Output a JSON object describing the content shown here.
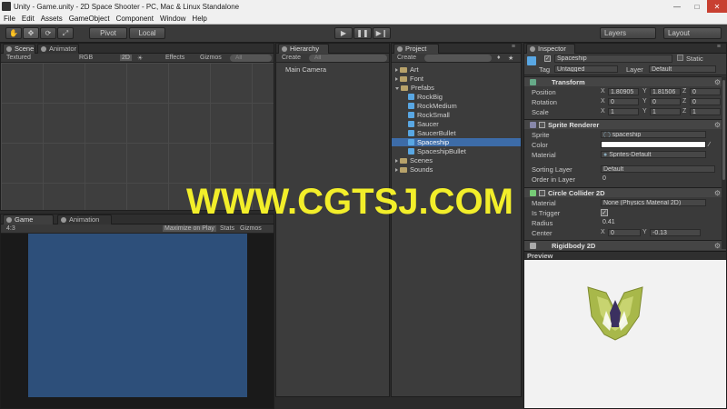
{
  "window": {
    "title": "Unity - Game.unity - 2D Space Shooter - PC, Mac & Linux Standalone"
  },
  "menu": [
    "File",
    "Edit",
    "Assets",
    "GameObject",
    "Component",
    "Window",
    "Help"
  ],
  "toolbar": {
    "pivot": "Pivot",
    "local": "Local",
    "layers": "Layers",
    "layout": "Layout"
  },
  "scene": {
    "tabs": [
      "Scene",
      "Animator"
    ],
    "shading": "Textured",
    "render": "RGB",
    "mode2d": "2D",
    "effects": "Effects",
    "gizmos": "Gizmos",
    "search": "All"
  },
  "game": {
    "tabs": [
      "Game",
      "Animation"
    ],
    "aspect": "4:3",
    "maximize": "Maximize on Play",
    "stats": "Stats",
    "gizmos": "Gizmos",
    "viewport_color": "#2d4f7a"
  },
  "hierarchy": {
    "tab": "Hierarchy",
    "create": "Create",
    "search": "All",
    "items": [
      "Main Camera"
    ]
  },
  "project": {
    "tab": "Project",
    "create": "Create",
    "items": [
      {
        "label": "Art",
        "type": "folder",
        "depth": 0,
        "open": false
      },
      {
        "label": "Font",
        "type": "folder",
        "depth": 0,
        "open": false
      },
      {
        "label": "Prefabs",
        "type": "folder",
        "depth": 0,
        "open": true
      },
      {
        "label": "RockBig",
        "type": "prefab",
        "depth": 1
      },
      {
        "label": "RockMedium",
        "type": "prefab",
        "depth": 1
      },
      {
        "label": "RockSmall",
        "type": "prefab",
        "depth": 1
      },
      {
        "label": "Saucer",
        "type": "prefab",
        "depth": 1
      },
      {
        "label": "SaucerBullet",
        "type": "prefab",
        "depth": 1
      },
      {
        "label": "Spaceship",
        "type": "prefab",
        "depth": 1,
        "selected": true
      },
      {
        "label": "SpaceshipBullet",
        "type": "prefab",
        "depth": 1
      },
      {
        "label": "Scenes",
        "type": "folder",
        "depth": 0,
        "open": false
      },
      {
        "label": "Sounds",
        "type": "folder",
        "depth": 0,
        "open": false
      }
    ]
  },
  "inspector": {
    "tab": "Inspector",
    "name": "Spaceship",
    "static": "Static",
    "tag_label": "Tag",
    "tag": "Untagged",
    "layer_label": "Layer",
    "layer": "Default",
    "transform": {
      "title": "Transform",
      "position_label": "Position",
      "position": [
        "1.80905",
        "1.81506",
        "0"
      ],
      "rotation_label": "Rotation",
      "rotation": [
        "0",
        "0",
        "0"
      ],
      "scale_label": "Scale",
      "scale": [
        "1",
        "1",
        "1"
      ]
    },
    "sprite_renderer": {
      "title": "Sprite Renderer",
      "sprite_label": "Sprite",
      "sprite": "spaceship",
      "color_label": "Color",
      "material_label": "Material",
      "material": "Sprites-Default",
      "sorting_layer_label": "Sorting Layer",
      "sorting_layer": "Default",
      "order_label": "Order in Layer",
      "order": "0"
    },
    "circle_collider": {
      "title": "Circle Collider 2D",
      "material_label": "Material",
      "material": "None (Physics Material 2D)",
      "trigger_label": "Is Trigger",
      "radius_label": "Radius",
      "radius": "0.41",
      "center_label": "Center",
      "center": [
        "0",
        "-0.13"
      ]
    },
    "rigidbody": {
      "title": "Rigidbody 2D"
    },
    "preview": "Preview",
    "axis": [
      "X",
      "Y",
      "Z"
    ]
  },
  "watermark": "WWW.CGTSJ.COM",
  "colors": {
    "selection": "#3d6ca8",
    "yellow": "#f2ee2a",
    "ship_green": "#a8b84a"
  }
}
